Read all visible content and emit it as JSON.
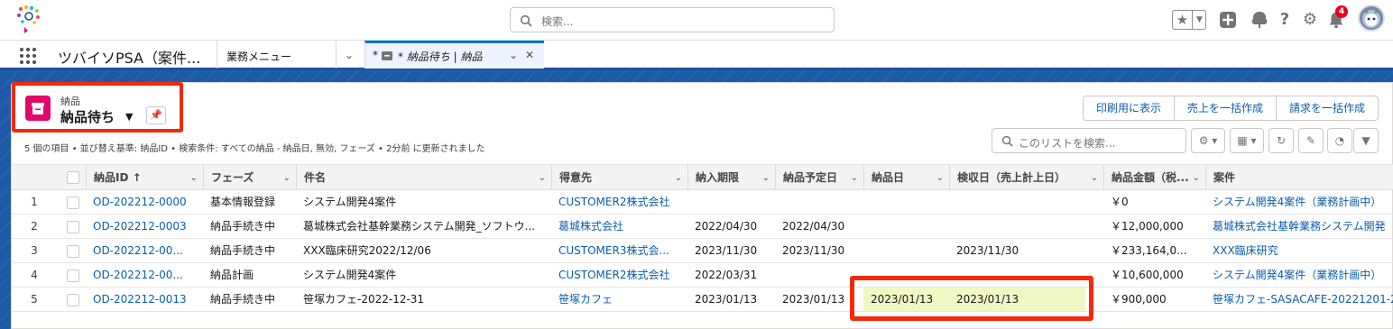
{
  "header": {
    "search_placeholder": "検索...",
    "notification_count": "4",
    "icons": [
      "favorites-star-icon",
      "favorites-caret-icon",
      "add-icon",
      "trailhead-icon",
      "help-icon",
      "setup-gear-icon",
      "bell-icon",
      "avatar"
    ]
  },
  "nav": {
    "app_name": "ツバイソPSA（案件...",
    "tabs": [
      {
        "label": "業務メニュー"
      },
      {
        "label": "* 納品待ち | 納品",
        "active": true
      }
    ]
  },
  "list": {
    "object_label": "納品",
    "view_name": "納品待ち",
    "meta": "5 個の項目 • 並び替え基準: 納品ID • 検索条件: すべての納品 - 納品日, 無効, フェーズ • 2分前 に更新されました",
    "search_placeholder": "このリストを検索...",
    "buttons": [
      "印刷用に表示",
      "売上を一括作成",
      "請求を一括作成"
    ],
    "icons": [
      "settings-icon",
      "display-as-table-icon",
      "refresh-icon",
      "edit-icon",
      "chart-icon",
      "filter-icon"
    ]
  },
  "table": {
    "columns": [
      "納品ID ↑",
      "フェーズ",
      "件名",
      "得意先",
      "納入期限",
      "納品予定日",
      "納品日",
      "検収日（売上計上日）",
      "納品金額（税...",
      "案件"
    ],
    "rows": [
      {
        "num": "1",
        "id": "OD-202212-0000",
        "phase": "基本情報登録",
        "subject": "システム開発4案件",
        "customer": "CUSTOMER2株式会社",
        "deadline": "",
        "planned": "",
        "delivered": "",
        "accepted": "",
        "amount": "￥0",
        "project": "システム開発4案件（業務計画中）"
      },
      {
        "num": "2",
        "id": "OD-202212-0003",
        "phase": "納品手続き中",
        "subject": "葛城株式会社基幹業務システム開発_ソフトウ...",
        "customer": "葛城株式会社",
        "deadline": "2022/04/30",
        "planned": "2022/04/30",
        "delivered": "",
        "accepted": "",
        "amount": "￥12,000,000",
        "project": "葛城株式会社基幹業務システム開発"
      },
      {
        "num": "3",
        "id": "OD-202212-00...",
        "phase": "納品手続き中",
        "subject": "XXX臨床研究2022/12/06",
        "customer": "CUSTOMER3株式会...",
        "deadline": "2023/11/30",
        "planned": "2023/11/30",
        "delivered": "",
        "accepted": "2023/11/30",
        "amount": "￥233,164,0...",
        "project": "XXX臨床研究"
      },
      {
        "num": "4",
        "id": "OD-202212-00...",
        "phase": "納品計画",
        "subject": "システム開発4案件",
        "customer": "CUSTOMER2株式会社",
        "deadline": "2022/03/31",
        "planned": "",
        "delivered": "",
        "accepted": "",
        "amount": "￥10,600,000",
        "project": "システム開発4案件（業務計画中）"
      },
      {
        "num": "5",
        "id": "OD-202212-0013",
        "phase": "納品手続き中",
        "subject": "笹塚カフェ-2022-12-31",
        "customer": "笹塚カフェ",
        "deadline": "2023/01/13",
        "planned": "2023/01/13",
        "delivered": "2023/01/13",
        "accepted": "2023/01/13",
        "amount": "￥900,000",
        "project": "笹塚カフェ-SASACAFE-20221201-20"
      }
    ]
  },
  "colors": {
    "brand": "#1e5aa8",
    "object_icon": "#e3066a",
    "highlight": "#f0f7c2",
    "annotation": "#f3290c",
    "link": "#0b5cab"
  }
}
